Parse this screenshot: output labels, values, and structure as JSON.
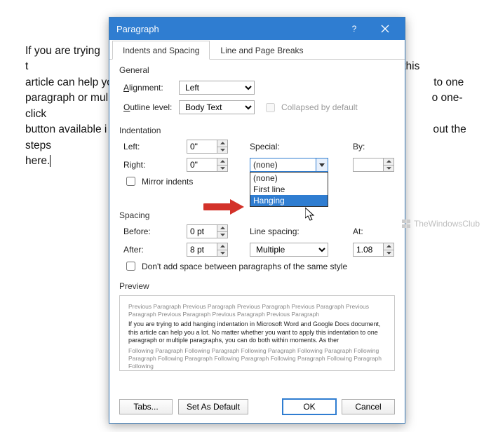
{
  "background": {
    "paragraph1": "If you are trying to",
    "paragraph2": "document, this article can help you",
    "paragraph3": "to one paragraph or multi",
    "paragraph4": "no one-click button available i",
    "paragraph5": "out the steps here."
  },
  "dialog": {
    "title": "Paragraph",
    "tabs": {
      "indents": "Indents and Spacing",
      "lineBreaks": "Line and Page Breaks"
    },
    "general": {
      "title": "General",
      "alignmentLabel": "Alignment:",
      "alignmentValue": "Left",
      "outlineLabel": "Outline level:",
      "outlineValue": "Body Text",
      "collapsed": "Collapsed by default"
    },
    "indent": {
      "title": "Indentation",
      "leftLabel": "Left:",
      "leftValue": "0\"",
      "rightLabel": "Right:",
      "rightValue": "0\"",
      "specialLabel": "Special:",
      "specialValue": "(none)",
      "byLabel": "By:",
      "byValue": "",
      "mirror": "Mirror indents",
      "options": {
        "none": "(none)",
        "first": "First line",
        "hanging": "Hanging"
      }
    },
    "spacing": {
      "title": "Spacing",
      "beforeLabel": "Before:",
      "beforeValue": "0 pt",
      "afterLabel": "After:",
      "afterValue": "8 pt",
      "lineSpacingLabel": "Line spacing:",
      "lineSpacingValue": "Multiple",
      "atLabel": "At:",
      "atValue": "1.08",
      "dontAdd": "Don't add space between paragraphs of the same style"
    },
    "preview": {
      "title": "Preview",
      "ghost": "Previous Paragraph Previous Paragraph Previous Paragraph Previous Paragraph Previous Paragraph Previous Paragraph Previous Paragraph Previous Paragraph",
      "main": "If you are trying to add hanging indentation in Microsoft Word and Google Docs document, this article can help you a lot. No matter whether you want to apply this indentation to one paragraph or multiple paragraphs, you can do both within moments. As ther",
      "ghost2": "Following Paragraph Following Paragraph Following Paragraph Following Paragraph Following Paragraph Following Paragraph Following Paragraph Following Paragraph Following Paragraph Following"
    },
    "buttons": {
      "tabs": "Tabs...",
      "setDefault": "Set As Default",
      "ok": "OK",
      "cancel": "Cancel"
    }
  },
  "watermark": "TheWindowsClub"
}
